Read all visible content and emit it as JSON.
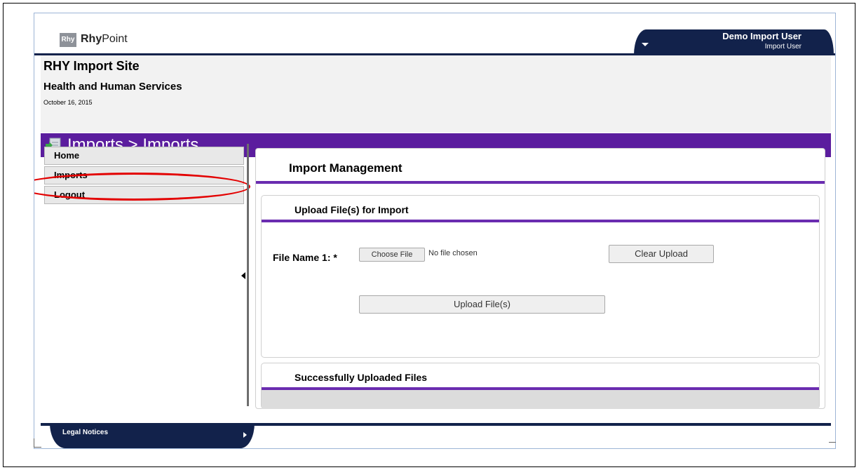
{
  "app": {
    "logo_abbrev": "Rhy",
    "logo_bold": "Rhy",
    "logo_rest": "Point"
  },
  "user": {
    "name": "Demo Import User",
    "role": "Import User"
  },
  "header": {
    "site_title": "RHY Import Site",
    "department": "Health and Human Services",
    "date": "October 16, 2015"
  },
  "breadcrumb": {
    "title": "Imports > Imports"
  },
  "nav": {
    "items": [
      {
        "label": "Home"
      },
      {
        "label": "Imports"
      },
      {
        "label": "Logout"
      }
    ]
  },
  "main": {
    "title": "Import Management",
    "upload_section": {
      "title": "Upload File(s) for Import",
      "file_label": "File Name 1: *",
      "choose_button": "Choose File",
      "no_file_text": "No file chosen",
      "clear_button": "Clear Upload",
      "upload_button": "Upload File(s)"
    },
    "uploaded_section": {
      "title": "Successfully Uploaded Files"
    }
  },
  "footer": {
    "label": "Legal Notices"
  },
  "colors": {
    "navy": "#12224b",
    "purple": "#5b1d9e",
    "highlight_red": "#e30000"
  }
}
